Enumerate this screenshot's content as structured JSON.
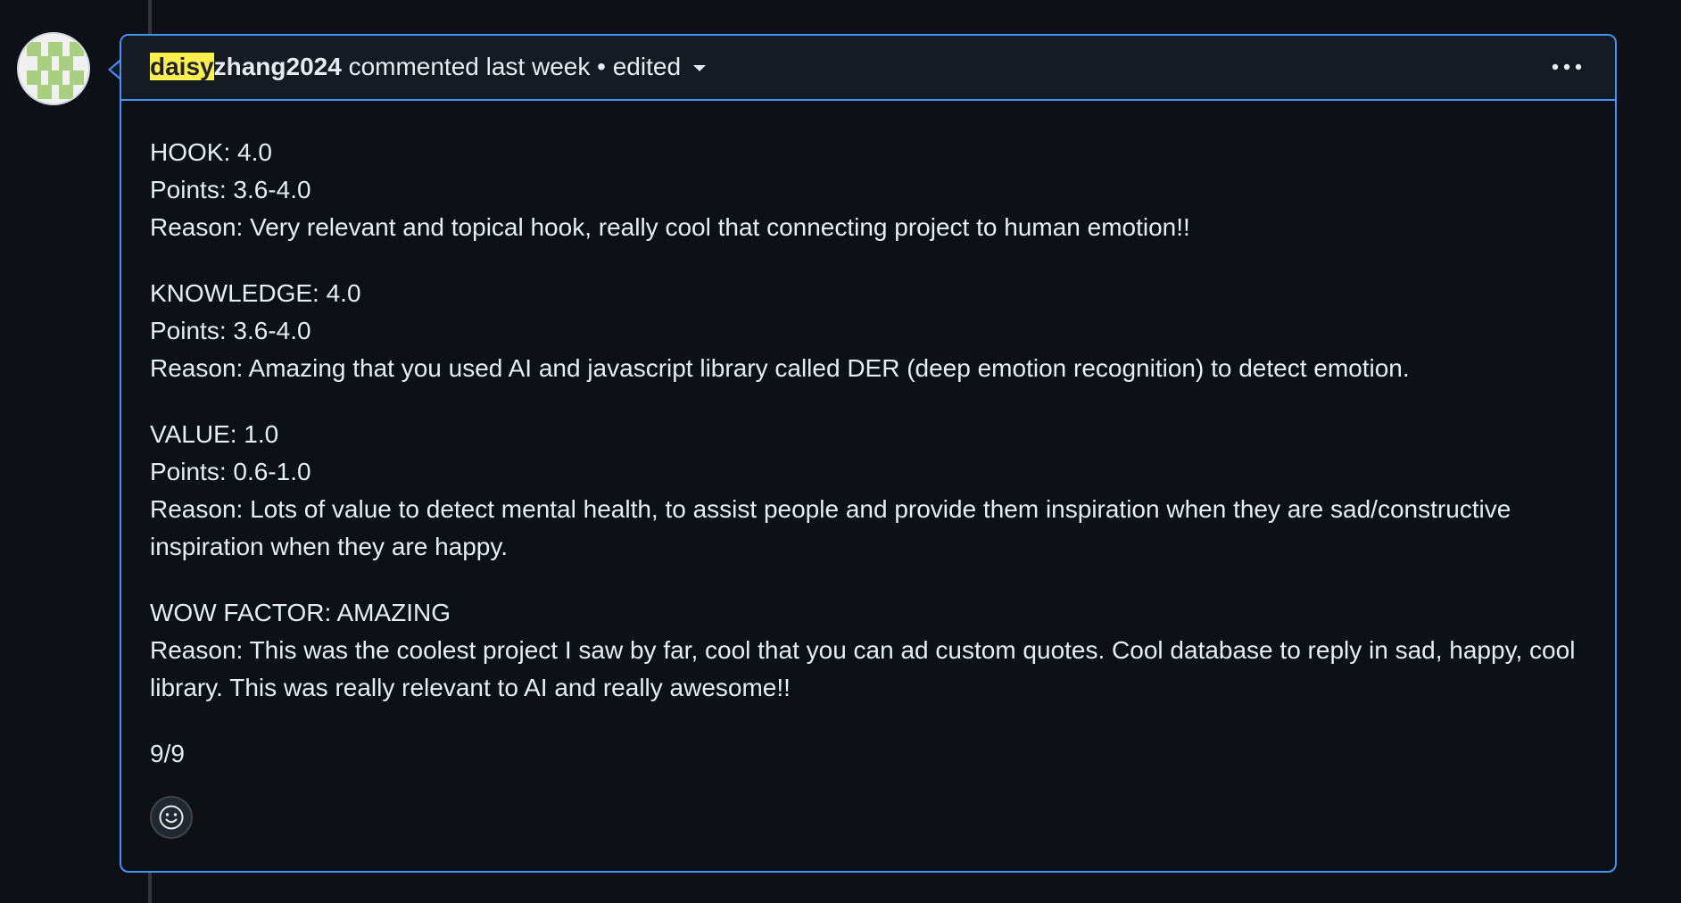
{
  "comment": {
    "author_highlighted": "daisy",
    "author_rest": "zhang2024",
    "action_text": "commented last week",
    "separator": "•",
    "edited_label": "edited",
    "menu_icon": "kebab-horizontal-icon",
    "reaction_icon": "smiley-icon",
    "sections": [
      {
        "lines": [
          "HOOK: 4.0",
          "Points: 3.6-4.0",
          "Reason: Very relevant and topical hook, really cool that connecting project to human emotion!!"
        ]
      },
      {
        "lines": [
          "KNOWLEDGE: 4.0",
          "Points: 3.6-4.0",
          "Reason: Amazing that you used AI and javascript library called DER (deep emotion recognition) to detect emotion."
        ]
      },
      {
        "lines": [
          "VALUE: 1.0",
          "Points: 0.6-1.0",
          "Reason: Lots of value to detect mental health, to assist people and provide them inspiration when they are sad/constructive inspiration when they are happy."
        ]
      },
      {
        "lines": [
          "WOW FACTOR: AMAZING",
          "Reason: This was the coolest project I saw by far, cool that you can ad custom quotes. Cool database to reply in sad, happy, cool library. This was really relevant to AI and really awesome!!"
        ]
      },
      {
        "lines": [
          "9/9"
        ]
      }
    ]
  },
  "colors": {
    "background": "#0d1117",
    "header_background": "#151b23",
    "border_accent": "#4493f8",
    "highlight": "#fff04d",
    "text": "#e6edf3"
  }
}
